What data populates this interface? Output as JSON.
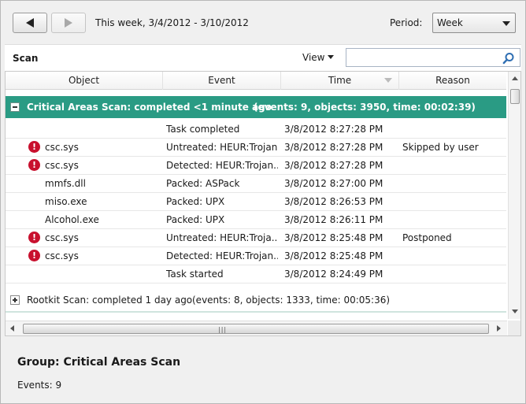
{
  "toolbar": {
    "back_button": "Back",
    "forward_button": "Forward",
    "period_text": "This week, 3/4/2012 - 3/10/2012",
    "period_label": "Period:",
    "period_value": "Week"
  },
  "scan": {
    "title": "Scan",
    "view_label": "View",
    "search_placeholder": ""
  },
  "columns": [
    "Object",
    "Event",
    "Time",
    "Reason"
  ],
  "groups": {
    "critical": {
      "title": "Critical Areas Scan: completed <1 minute ago",
      "stats": "(events: 9, objects: 3950, time: 00:02:39)",
      "rows": [
        {
          "object": "",
          "event": "Task completed",
          "time": "3/8/2012 8:27:28 PM",
          "reason": ""
        },
        {
          "object": "csc.sys",
          "event": "Untreated: HEUR:Trojan...",
          "time": "3/8/2012 8:27:28 PM",
          "reason": "Skipped by user"
        },
        {
          "object": "csc.sys",
          "event": "Detected: HEUR:Trojan...",
          "time": "3/8/2012 8:27:28 PM",
          "reason": ""
        },
        {
          "object": "mmfs.dll",
          "event": "Packed: ASPack",
          "time": "3/8/2012 8:27:00 PM",
          "reason": ""
        },
        {
          "object": "miso.exe",
          "event": "Packed: UPX",
          "time": "3/8/2012 8:26:53 PM",
          "reason": ""
        },
        {
          "object": "Alcohol.exe",
          "event": "Packed: UPX",
          "time": "3/8/2012 8:26:11 PM",
          "reason": ""
        },
        {
          "object": "csc.sys",
          "event": "Untreated: HEUR:Troja...",
          "time": "3/8/2012 8:25:48 PM",
          "reason": "Postponed"
        },
        {
          "object": "csc.sys",
          "event": "Detected: HEUR:Trojan...",
          "time": "3/8/2012 8:25:48 PM",
          "reason": ""
        },
        {
          "object": "",
          "event": "Task started",
          "time": "3/8/2012 8:24:49 PM",
          "reason": ""
        }
      ]
    },
    "rootkit": {
      "title": "Rootkit Scan: completed 1 day ago",
      "stats": "(events: 8, objects: 1333, time: 00:05:36)"
    }
  },
  "details": {
    "group_title": "Group: Critical Areas Scan",
    "events": "Events: 9"
  },
  "colors": {
    "group_highlight": "#2a9b84",
    "warning": "#c8102e"
  }
}
